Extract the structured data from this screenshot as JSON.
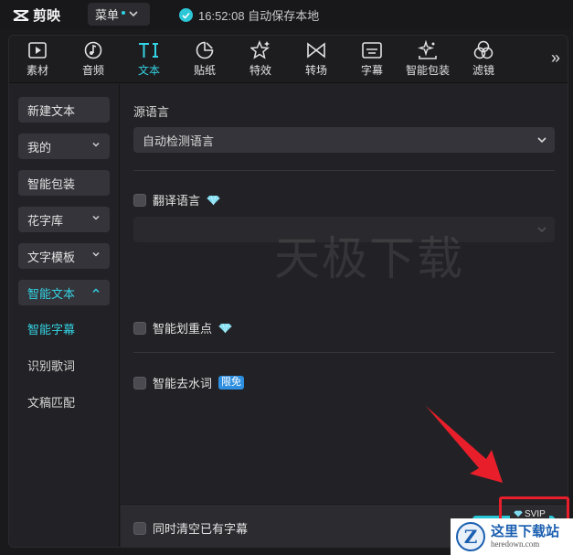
{
  "app": {
    "name": "剪映",
    "menu_label": "菜单",
    "save_status": "16:52:08 自动保存本地"
  },
  "toolbar_tabs": [
    {
      "label": "素材",
      "icon": "media-icon",
      "active": false
    },
    {
      "label": "音频",
      "icon": "music-note-icon",
      "active": false
    },
    {
      "label": "文本",
      "icon": "text-icon",
      "active": true
    },
    {
      "label": "贴纸",
      "icon": "sticker-icon",
      "active": false
    },
    {
      "label": "特效",
      "icon": "effects-star-icon",
      "active": false
    },
    {
      "label": "转场",
      "icon": "transition-icon",
      "active": false
    },
    {
      "label": "字幕",
      "icon": "subtitle-icon",
      "active": false
    },
    {
      "label": "智能包装",
      "icon": "sparkle-package-icon",
      "active": false
    },
    {
      "label": "滤镜",
      "icon": "filter-icon",
      "active": false
    }
  ],
  "toolbar_more": "»",
  "sidebar": {
    "items": [
      {
        "label": "新建文本"
      },
      {
        "label": "我的"
      },
      {
        "label": "智能包装"
      },
      {
        "label": "花字库"
      },
      {
        "label": "文字模板"
      },
      {
        "label": "智能文本"
      }
    ],
    "subitems": [
      {
        "label": "智能字幕",
        "active": true
      },
      {
        "label": "识别歌词",
        "active": false
      },
      {
        "label": "文稿匹配",
        "active": false
      }
    ]
  },
  "content": {
    "source_language_label": "源语言",
    "source_language_value": "自动检测语言",
    "translate_label": "翻译语言",
    "highlight_label": "智能划重点",
    "remove_filler_label": "智能去水词",
    "free_badge": "限免",
    "clear_subtitles_label": "同时清空已有字幕",
    "svip_badge": "SVIP"
  },
  "watermark": "天极下载",
  "site_logo": {
    "mark": "Z",
    "cn": "这里下载站",
    "en": "heredown.com"
  },
  "colors": {
    "accent": "#34d3e3",
    "annotation_red": "#e81f2b",
    "free_badge_blue": "#2e8fe0"
  }
}
